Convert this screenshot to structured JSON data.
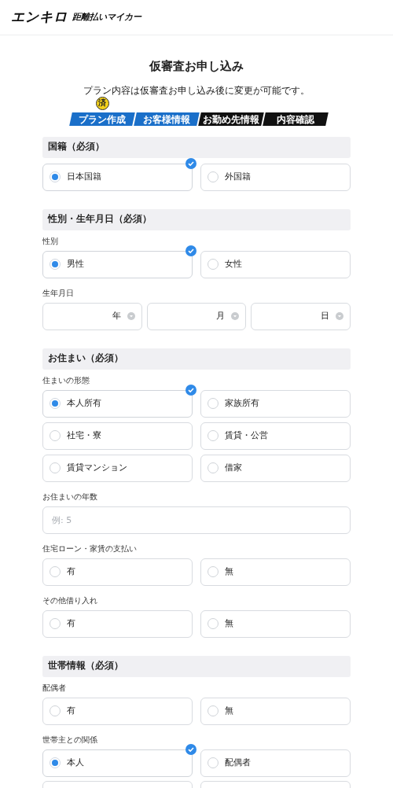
{
  "header": {
    "logo": "エンキロ",
    "tagline": "距離払いマイカー"
  },
  "title": "仮審査お申し込み",
  "subtitle": "プラン内容は仮審査お申し込み後に変更が可能です。",
  "steps": [
    {
      "label": "プラン作成",
      "done": true,
      "badge": "済"
    },
    {
      "label": "お客様情報",
      "done": true
    },
    {
      "label": "お勤め先情報",
      "done": false
    },
    {
      "label": "内容確認",
      "done": false
    }
  ],
  "sections": [
    {
      "title": "国籍（必須）",
      "fields": [
        {
          "kind": "radio",
          "options": [
            {
              "label": "日本国籍",
              "selected": true
            },
            {
              "label": "外国籍",
              "selected": false
            }
          ]
        }
      ]
    },
    {
      "title": "性別・生年月日（必須）",
      "fields": [
        {
          "kind": "radio",
          "label": "性別",
          "options": [
            {
              "label": "男性",
              "selected": true
            },
            {
              "label": "女性",
              "selected": false
            }
          ]
        },
        {
          "kind": "date",
          "label": "生年月日",
          "parts": [
            "年",
            "月",
            "日"
          ]
        }
      ]
    },
    {
      "title": "お住まい（必須）",
      "fields": [
        {
          "kind": "radio",
          "label": "住まいの形態",
          "options": [
            {
              "label": "本人所有",
              "selected": true
            },
            {
              "label": "家族所有",
              "selected": false
            },
            {
              "label": "社宅・寮",
              "selected": false
            },
            {
              "label": "賃貸・公営",
              "selected": false
            },
            {
              "label": "賃貸マンション",
              "selected": false
            },
            {
              "label": "借家",
              "selected": false
            }
          ]
        },
        {
          "kind": "text",
          "label": "お住まいの年数",
          "placeholder": "例: 5"
        },
        {
          "kind": "radio",
          "label": "住宅ローン・家賃の支払い",
          "options": [
            {
              "label": "有",
              "selected": false
            },
            {
              "label": "無",
              "selected": false
            }
          ]
        },
        {
          "kind": "radio",
          "label": "その他借り入れ",
          "options": [
            {
              "label": "有",
              "selected": false
            },
            {
              "label": "無",
              "selected": false
            }
          ]
        }
      ]
    },
    {
      "title": "世帯情報（必須）",
      "fields": [
        {
          "kind": "radio",
          "label": "配偶者",
          "options": [
            {
              "label": "有",
              "selected": false
            },
            {
              "label": "無",
              "selected": false
            }
          ]
        },
        {
          "kind": "radio",
          "label": "世帯主との関係",
          "options": [
            {
              "label": "本人",
              "selected": true
            },
            {
              "label": "配偶者",
              "selected": false
            }
          ]
        }
      ]
    }
  ]
}
